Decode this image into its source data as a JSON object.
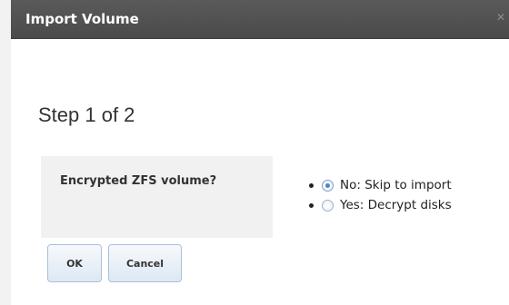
{
  "dialog": {
    "title": "Import Volume",
    "close_icon": "close-icon"
  },
  "wizard": {
    "step_text": "Step 1 of 2"
  },
  "form": {
    "field_label": "Encrypted ZFS volume?",
    "options": [
      {
        "label": "No: Skip to import",
        "selected": true
      },
      {
        "label": "Yes: Decrypt disks",
        "selected": false
      }
    ]
  },
  "buttons": {
    "ok_label": "OK",
    "cancel_label": "Cancel"
  }
}
